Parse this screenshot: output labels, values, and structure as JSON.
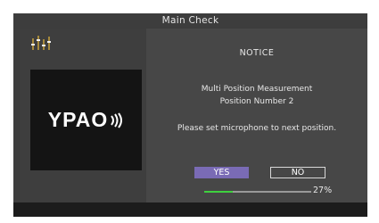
{
  "window": {
    "title": "Main Check"
  },
  "logo": {
    "text": "YPAO"
  },
  "dialog": {
    "heading": "NOTICE",
    "message_line1": "Multi Position Measurement",
    "message_line2": "Position Number 2",
    "instruction": "Please set microphone to next position."
  },
  "buttons": {
    "yes_label": "YES",
    "no_label": "NO",
    "selected": "YES"
  },
  "progress": {
    "value": 0.27,
    "label": "27%",
    "fill_color": "#3fd13f"
  },
  "colors": {
    "selected_button": "#7a6bb5",
    "background": "#474747"
  },
  "icons": {
    "equalizer": "equalizer-icon",
    "logo_mark": "sound-wave-icon"
  }
}
